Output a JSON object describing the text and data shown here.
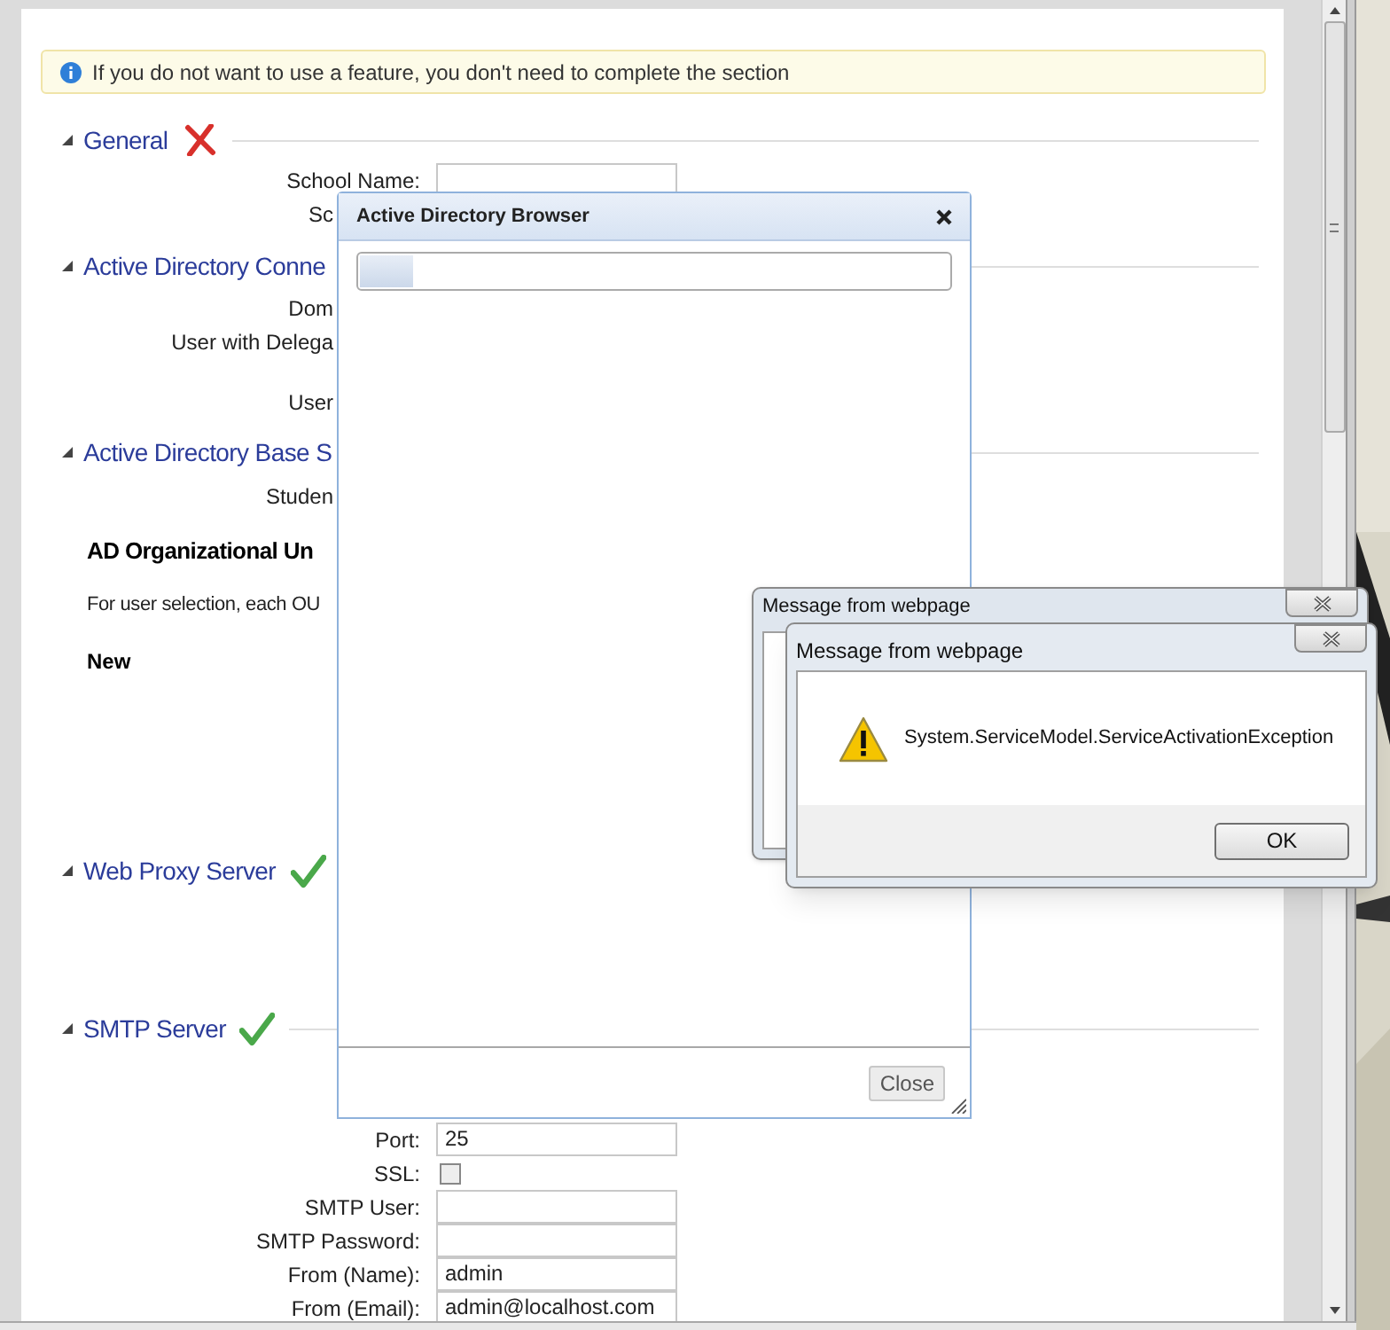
{
  "notice": {
    "text": "If you do not want to use a feature, you don't need to complete the section"
  },
  "sections": [
    {
      "title": "General",
      "expanded": true,
      "valid": false,
      "items": [
        {
          "kind": "field",
          "label": "School Name:"
        },
        {
          "kind": "label",
          "label": "Sc"
        }
      ]
    },
    {
      "title": "Active Directory Conne",
      "expanded": true,
      "items": [
        {
          "kind": "label",
          "label": "Dom"
        },
        {
          "kind": "label",
          "label": "User with Delega"
        },
        {
          "kind": "label",
          "label": "User"
        }
      ]
    },
    {
      "title": "Active Directory Base S",
      "expanded": true,
      "items": [
        {
          "kind": "label",
          "label": "Studen"
        },
        {
          "kind": "heading",
          "label": "AD Organizational Un"
        },
        {
          "kind": "paragraph",
          "label": "For user selection, each OU"
        },
        {
          "kind": "subheading",
          "label": "New"
        }
      ]
    },
    {
      "title": "Web Proxy Server",
      "expanded": true,
      "valid": true
    },
    {
      "title": "SMTP Server",
      "expanded": true,
      "valid": true,
      "items": [
        {
          "kind": "field",
          "label": "Port:",
          "value": "25"
        },
        {
          "kind": "checkbox",
          "label": "SSL:",
          "checked": false
        },
        {
          "kind": "field",
          "label": "SMTP User:"
        },
        {
          "kind": "field",
          "label": "SMTP Password:"
        },
        {
          "kind": "field",
          "label": "From (Name):",
          "value": "admin"
        },
        {
          "kind": "field",
          "label": "From (Email):",
          "value": "admin@localhost.com"
        }
      ]
    }
  ],
  "browser_dialog": {
    "title": "Active Directory Browser",
    "loading": {
      "level": 0.09
    },
    "close_button": "Close"
  },
  "message_boxes": [
    {
      "title": "Message from webpage"
    },
    {
      "title": "Message from webpage",
      "message": "System.ServiceModel.ServiceActivationException",
      "ok_button": "OK"
    }
  ]
}
